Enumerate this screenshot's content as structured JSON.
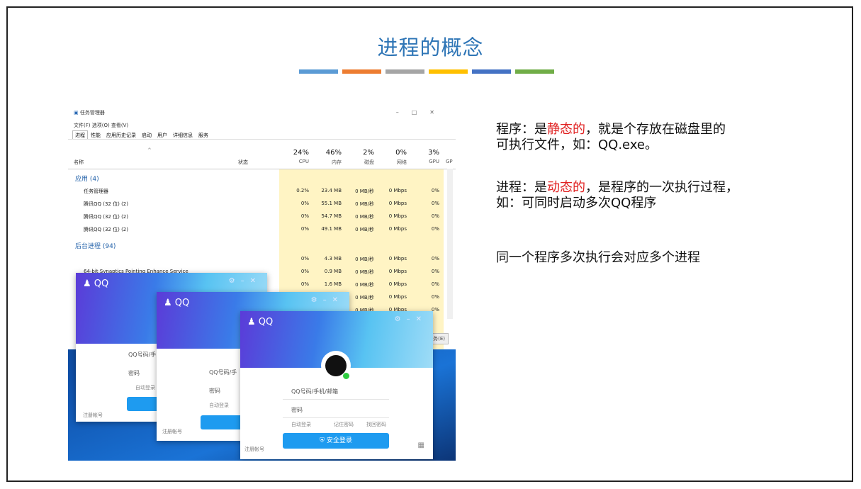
{
  "slide": {
    "title": "进程的概念",
    "bar_colors": [
      "#5b9bd5",
      "#ed7d31",
      "#a5a5a5",
      "#ffc000",
      "#4472c4",
      "#70ad47"
    ]
  },
  "task_manager": {
    "window_title": "任务管理器",
    "menu": "文件(F)  选项(O)  查看(V)",
    "tabs": [
      "进程",
      "性能",
      "应用历史记录",
      "启动",
      "用户",
      "详细信息",
      "服务"
    ],
    "col_name": "名称",
    "col_status": "状态",
    "cols": [
      {
        "pct": "24%",
        "name": "CPU"
      },
      {
        "pct": "46%",
        "name": "内存"
      },
      {
        "pct": "2%",
        "name": "磁盘"
      },
      {
        "pct": "0%",
        "name": "网络"
      },
      {
        "pct": "3%",
        "name": "GPU"
      }
    ],
    "col_gpu_extra": "GP",
    "group_apps": "应用 (4)",
    "group_bg": "后台进程 (94)",
    "rows": [
      {
        "name": "任务管理器",
        "cpu": "0.2%",
        "mem": "23.4 MB",
        "disk": "0 MB/秒",
        "net": "0 Mbps",
        "gpu": "0%"
      },
      {
        "name": "腾讯QQ (32 位) (2)",
        "cpu": "0%",
        "mem": "55.1 MB",
        "disk": "0 MB/秒",
        "net": "0 Mbps",
        "gpu": "0%"
      },
      {
        "name": "腾讯QQ (32 位) (2)",
        "cpu": "0%",
        "mem": "54.7 MB",
        "disk": "0 MB/秒",
        "net": "0 Mbps",
        "gpu": "0%"
      },
      {
        "name": "腾讯QQ (32 位) (2)",
        "cpu": "0%",
        "mem": "49.1 MB",
        "disk": "0 MB/秒",
        "net": "0 Mbps",
        "gpu": "0%"
      }
    ],
    "bg_rows": [
      {
        "name": "",
        "cpu": "0%",
        "mem": "4.3 MB",
        "disk": "0 MB/秒",
        "net": "0 Mbps",
        "gpu": "0%"
      },
      {
        "name": "64-bit Synaptics Pointing Enhance Service",
        "cpu": "0%",
        "mem": "0.9 MB",
        "disk": "0 MB/秒",
        "net": "0 Mbps",
        "gpu": "0%"
      },
      {
        "name": "",
        "cpu": "0%",
        "mem": "1.6 MB",
        "disk": "0 MB/秒",
        "net": "0 Mbps",
        "gpu": "0%"
      },
      {
        "name": "",
        "cpu": "",
        "mem": "",
        "disk": "0 MB/秒",
        "net": "0 Mbps",
        "gpu": "0%"
      },
      {
        "name": "",
        "cpu": "",
        "mem": "",
        "disk": "0 MB/秒",
        "net": "0 Mbps",
        "gpu": "0%"
      }
    ],
    "end_task": "任务(E)"
  },
  "qq": {
    "brand": "QQ",
    "account_placeholder": "QQ号码/手机/邮箱",
    "account_short1": "QQ号码/手",
    "account_short2": "QQ号码/手",
    "password": "密码",
    "auto_login": "自动登录",
    "remember": "记住密码",
    "retrieve": "找回密码",
    "login_button": "安全登录",
    "register": "注册帐号"
  },
  "notes": {
    "p1_a": "程序：是",
    "p1_red": "静态的",
    "p1_b": "，就是个存放在磁盘里的",
    "p1_c": "可执行文件，如：QQ.exe。",
    "p2_a": "进程：是",
    "p2_red": "动态的",
    "p2_b": "，是程序的一次执行过程，",
    "p2_c": "如：可同时启动多次QQ程序",
    "p3": "同一个程序多次执行会对应多个进程"
  }
}
